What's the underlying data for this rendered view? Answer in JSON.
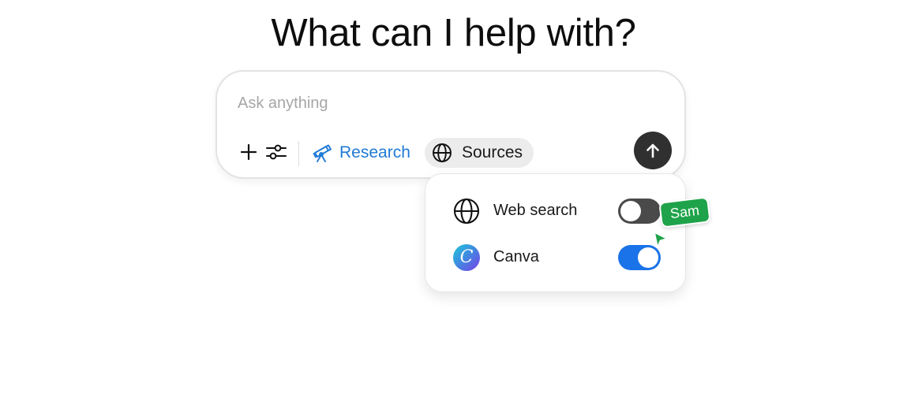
{
  "headline": "What can I help with?",
  "composer": {
    "placeholder": "Ask anything",
    "value": "",
    "research_label": "Research",
    "sources_label": "Sources",
    "icons": {
      "add": "plus-icon",
      "tools": "sliders-icon",
      "research": "telescope-icon",
      "sources": "globe-icon",
      "send": "arrow-up-icon"
    }
  },
  "sources_menu": {
    "items": [
      {
        "label": "Web search",
        "icon": "globe-icon",
        "enabled": false
      },
      {
        "label": "Canva",
        "icon": "canva-logo",
        "icon_text": "C",
        "enabled": true
      }
    ]
  },
  "collaborator_cursor": {
    "name": "Sam",
    "color": "#1fa34a"
  },
  "colors": {
    "accent_blue": "#1f7ad6",
    "toggle_on": "#1a73e8",
    "toggle_off": "#4a4a4a",
    "send_button": "#303030"
  }
}
